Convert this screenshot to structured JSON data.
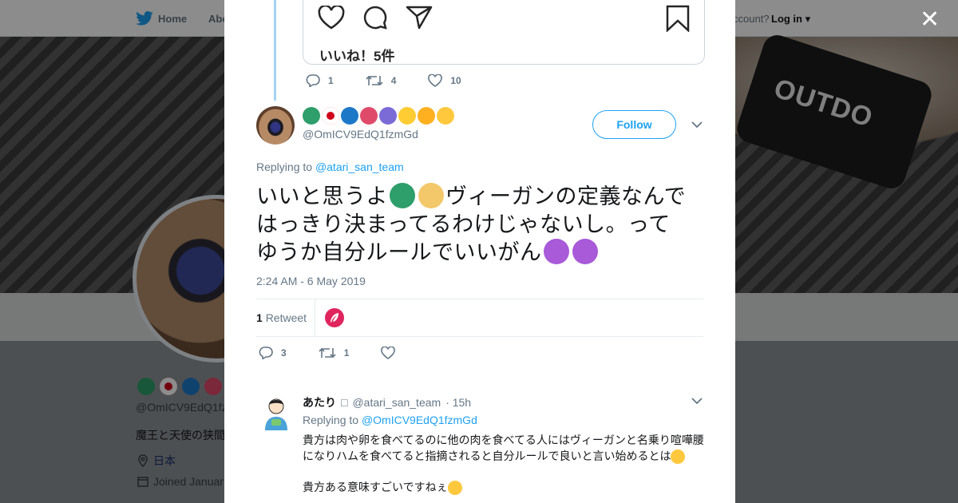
{
  "topbar": {
    "home_label": "Home",
    "about_label": "Abo",
    "account_text": "ccount?",
    "login_label": "Log in ▾"
  },
  "banner": {
    "tag_text": "OUTDO"
  },
  "profile_side": {
    "handle": "@OmICV9EdQ1fz",
    "bio": "魔王と天使の狭間",
    "location": "日本",
    "joined": "Joined Januar"
  },
  "modal": {
    "close_glyph": "✕",
    "quoted": {
      "likes_text": "いいね！5件"
    },
    "parent_actions": {
      "replies": "1",
      "retweets": "4",
      "likes": "10"
    },
    "tweet": {
      "handle": "@OmICV9EdQ1fzmGd",
      "follow_label": "Follow",
      "replying_prefix": "Replying to ",
      "replying_to": "@atari_san_team",
      "text_line1": "いいと思うよ",
      "text_line1b": "ヴィーガンの定義なんで",
      "text_line2": "はっきり決まってるわけじゃないし。って",
      "text_line3": "ゆうか自分ルールでいいがん",
      "time": "2:24 AM - 6 May 2019",
      "retweet_count": "1",
      "retweet_label": "Retweet",
      "actions": {
        "replies": "3",
        "retweets": "1"
      }
    },
    "reply": {
      "name": "あたり",
      "badge": "□",
      "handle": "@atari_san_team",
      "age": "· 15h",
      "replying_prefix": "Replying to ",
      "replying_to": "@OmICV9EdQ1fzmGd",
      "text": "貴方は肉や卵を食べてるのに他の肉を食べてる人にはヴィーガンと名乗り喧嘩腰になりハムを食べてると指摘されると自分ルールで良いと言い始めるとは",
      "text2": "貴方ある意味すごいですねぇ"
    }
  },
  "colors": {
    "accent": "#1da1f2",
    "like": "#e0245e",
    "thread": "#a6d2f2"
  }
}
